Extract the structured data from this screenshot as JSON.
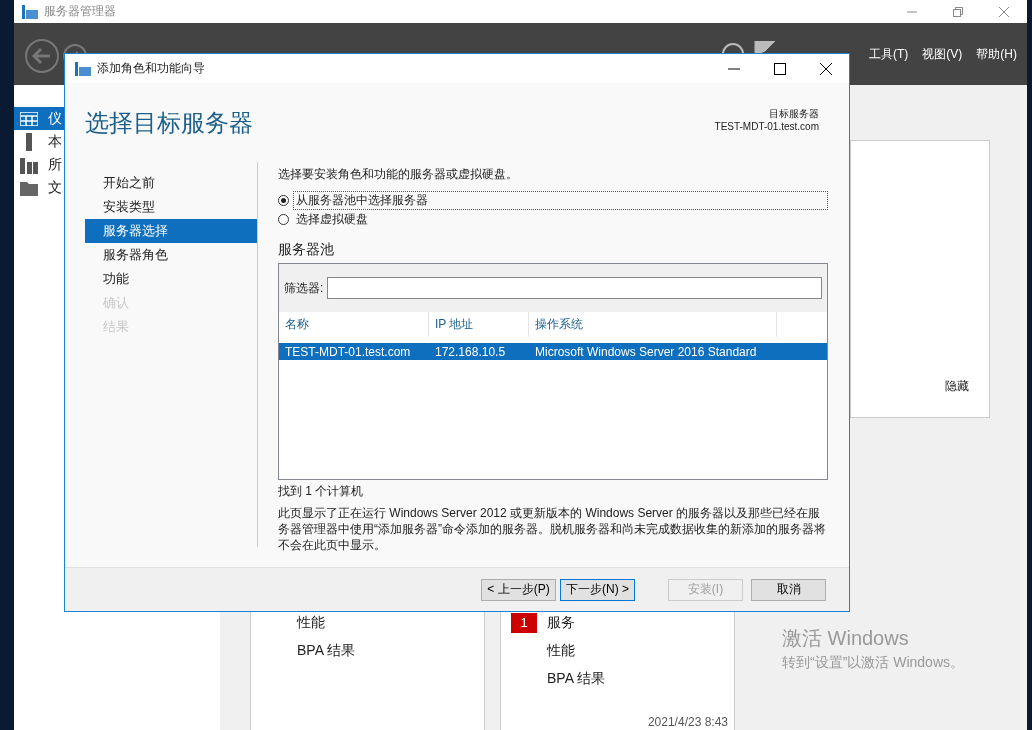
{
  "server_manager": {
    "title": "服务器管理器",
    "menu": [
      "工具(T)",
      "视图(V)",
      "帮助(H)"
    ],
    "nav": [
      {
        "label": "仪",
        "kind": "dashboard",
        "selected": true
      },
      {
        "label": "本",
        "kind": "local",
        "selected": false
      },
      {
        "label": "所",
        "kind": "all",
        "selected": false
      },
      {
        "label": "文",
        "kind": "files",
        "selected": false
      }
    ],
    "panel_link": "隐藏",
    "tiles": [
      {
        "items": [
          {
            "label": "性能"
          },
          {
            "label": "BPA 结果"
          }
        ]
      },
      {
        "items": [
          {
            "label": "服务",
            "badge": "1"
          },
          {
            "label": "性能"
          },
          {
            "label": "BPA 结果"
          }
        ],
        "timestamp": "2021/4/23 8:43"
      }
    ],
    "activation": {
      "title": "激活 Windows",
      "text": "转到“设置”以激活 Windows。"
    }
  },
  "dialog": {
    "title": "添加角色和功能向导",
    "heading": "选择目标服务器",
    "target_label": "目标服务器",
    "target_server": "TEST-MDT-01.test.com",
    "steps": [
      {
        "label": "开始之前",
        "selected": false,
        "disabled": false
      },
      {
        "label": "安装类型",
        "selected": false,
        "disabled": false
      },
      {
        "label": "服务器选择",
        "selected": true,
        "disabled": false
      },
      {
        "label": "服务器角色",
        "selected": false,
        "disabled": false
      },
      {
        "label": "功能",
        "selected": false,
        "disabled": false
      },
      {
        "label": "确认",
        "selected": false,
        "disabled": true
      },
      {
        "label": "结果",
        "selected": false,
        "disabled": true
      }
    ],
    "instruction": "选择要安装角色和功能的服务器或虚拟硬盘。",
    "options": [
      {
        "label": "从服务器池中选择服务器",
        "selected": true
      },
      {
        "label": "选择虚拟硬盘",
        "selected": false
      }
    ],
    "pool_label": "服务器池",
    "filter_label": "筛选器:",
    "columns": [
      "名称",
      "IP 地址",
      "操作系统"
    ],
    "rows": [
      {
        "cells": [
          "TEST-MDT-01.test.com",
          "172.168.10.5",
          "Microsoft Windows Server 2016 Standard"
        ],
        "selected": true
      }
    ],
    "found": "找到 1 个计算机",
    "description": "此页显示了正在运行 Windows Server 2012 或更新版本的 Windows Server 的服务器以及那些已经在服务器管理器中使用“添加服务器”命令添加的服务器。脱机服务器和尚未完成数据收集的新添加的服务器将不会在此页中显示。",
    "buttons": [
      {
        "label": "< 上一步(P)",
        "kind": "back",
        "disabled": false
      },
      {
        "label": "下一步(N) >",
        "kind": "next",
        "disabled": false
      },
      {
        "label": "安装(I)",
        "kind": "install",
        "disabled": true
      },
      {
        "label": "取消",
        "kind": "cancel",
        "disabled": false
      }
    ]
  }
}
